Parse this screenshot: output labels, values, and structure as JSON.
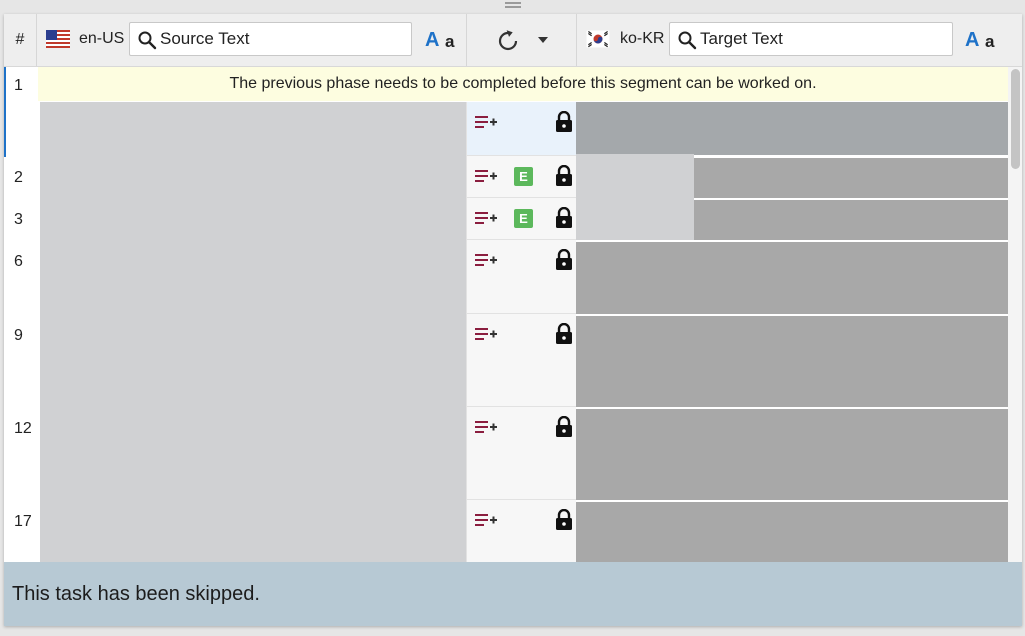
{
  "header": {
    "hash_label": "#",
    "source": {
      "lang": "en-US",
      "search_placeholder": "Source Text",
      "case_upper": "A",
      "case_lower": "a"
    },
    "target": {
      "lang": "ko-KR",
      "search_placeholder": "Target Text",
      "case_upper": "A",
      "case_lower": "a"
    }
  },
  "notice": "The previous phase needs to be completed before this segment can be worked on.",
  "rows": [
    {
      "num": "1",
      "badge": ""
    },
    {
      "num": "2",
      "badge": "E"
    },
    {
      "num": "3",
      "badge": "E"
    },
    {
      "num": "6",
      "badge": ""
    },
    {
      "num": "9",
      "badge": ""
    },
    {
      "num": "12",
      "badge": ""
    },
    {
      "num": "17",
      "badge": ""
    }
  ],
  "status": "This task has been skipped.",
  "colors": {
    "accent": "#1e72c8",
    "notice_bg": "#fdfde0",
    "badge_green": "#5cb85c",
    "status_bg": "#b7c9d4"
  },
  "icons": [
    "search-icon",
    "refresh-icon",
    "chevron-down-icon",
    "add-comment-icon",
    "lock-icon",
    "us-flag-icon",
    "kr-flag-icon"
  ]
}
